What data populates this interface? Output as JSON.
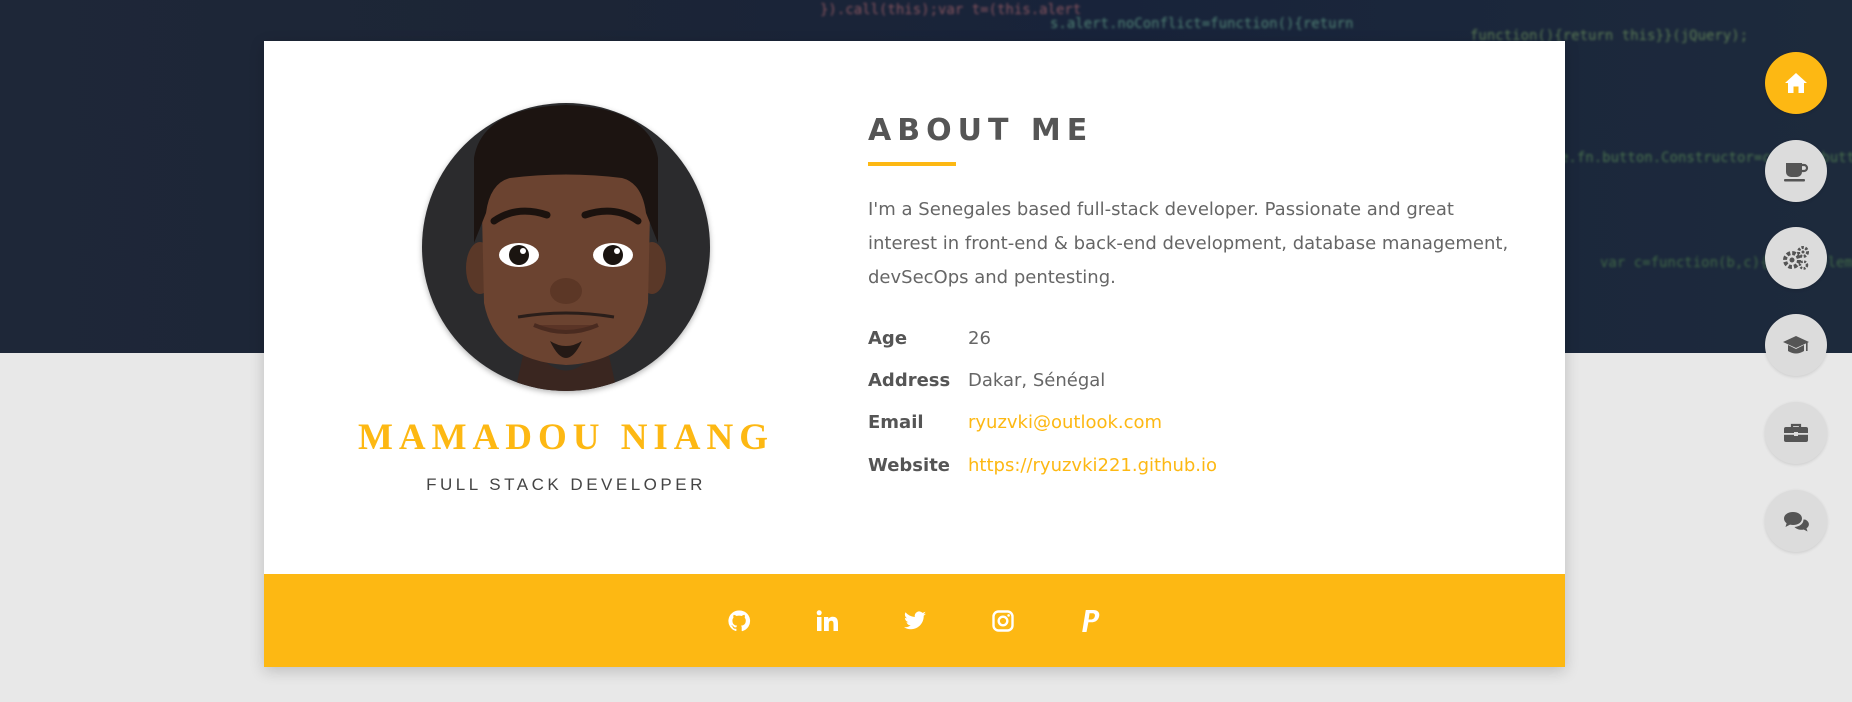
{
  "profile": {
    "name": "MAMADOU NIANG",
    "role": "FULL STACK DEVELOPER"
  },
  "about": {
    "title": "ABOUT ME",
    "text": "I'm a Senegales based full-stack developer. Passionate and great interest in front-end & back-end development, database management, devSecOps and pentesting.",
    "info": [
      {
        "label": "Age",
        "value": "26"
      },
      {
        "label": "Address",
        "value": "Dakar, Sénégal"
      },
      {
        "label": "Email",
        "value": "ryuzvki@outlook.com"
      },
      {
        "label": "Website",
        "value": "https://ryuzvki221.github.io"
      }
    ]
  },
  "social": [
    "github-icon",
    "linkedin-icon",
    "twitter-icon",
    "instagram-icon",
    "paypal-icon"
  ],
  "nav": [
    "home-icon",
    "coffee-icon",
    "gears-icon",
    "graduation-cap-icon",
    "briefcase-icon",
    "comments-icon"
  ],
  "background_code": [
    "s.alert.noConflict=function(){return",
    "}).call(this);var t=(this.alert",
    "function(){return this}}(jQuery);",
    "e.fn.button.Constructor=c,e.fn.button",
    "var c=function(b,c){this.$element=a(b)"
  ],
  "colors": {
    "accent": "#fdb813",
    "nav_inactive": "#dcdcdc",
    "heading": "#555555",
    "body_text": "#666666"
  }
}
